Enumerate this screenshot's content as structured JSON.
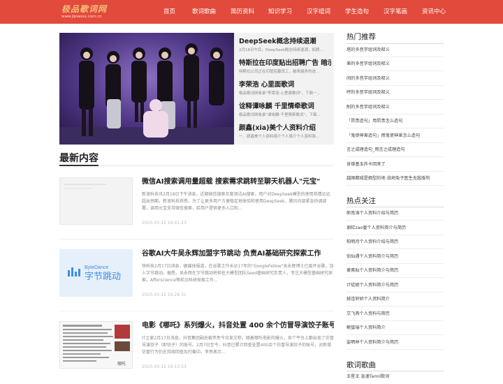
{
  "header": {
    "logo_name": "极品歌词网",
    "logo_url": "www.jlpiaoxx.com.cn",
    "nav": [
      "首页",
      "歌词歌曲",
      "简历资料",
      "知识学习",
      "汉字组词",
      "学生造句",
      "汉字笔画",
      "资讯中心"
    ]
  },
  "featured": {
    "headlines": [
      {
        "title": "DeepSeek概念持续退潮",
        "summary": "2月18日午后，DeepSeek概念持续退潮，拓朗..."
      },
      {
        "title": "特斯拉在印度贴出招聘广告 暗示",
        "summary": "特斯拉公司正在印度招募员工，越来越多的迹..."
      },
      {
        "title": "李荣浩 心里面歌词",
        "summary": "极品歌词网收录\"李荣浩-心里面歌词\"，下面一..."
      },
      {
        "title": "诠释谭咏麟 千里情牵歌词",
        "summary": "极品歌词网收录\"谭咏麟-千里情牵歌词\"，下面..."
      },
      {
        "title": "颜鑫(xia)美个人资料介绍",
        "summary": "一、颜鑫美个人资料简介个人简介个人资料简..."
      }
    ]
  },
  "latest": {
    "title": "最新内容",
    "articles": [
      {
        "title": "微信AI搜索调用量超载 搜索需求跳转至聊天机器人\"元宝\"",
        "summary": "新浪科技讯2月18日下午消息，近期微信搜索灰度测试AI搜索，用户对DeepSeek模型的使用热情远远超出预期，新浪科技获悉，为了让更多用户方便稳定地体验和使用DeepSeek，腾讯内部紧急协调部署，调用元宝支持微信搜索，给用户提供更多入口和...",
        "date": "2025-03-11 16:41:23",
        "thumb": "blank"
      },
      {
        "title": "谷歌AI大牛吴永辉加盟字节跳动 负责AI基础研究探索工作",
        "summary": "快科技2月17日消息，据媒体报道，在谷歌工作长达17年的\"GoogleFellow\"吴永辉博士已离开谷歌，加入字节跳动。据悉，吴永辉在字节跳动将担任大模型团队Seed基础研究负责人，专注大模型基础研究探索，Afforscience等前沿科研探索工作...",
        "date": "2025-03-11 16:28:31",
        "thumb": "bytedance",
        "thumb_en": "ByteDance",
        "thumb_cn": "字节跳动"
      },
      {
        "title": "电影《哪吒》系列爆火，抖音处置 400 余个仿冒导演饺子账号",
        "summary": "IT之家2月17日消息，抖音集团副总裁李亮今日发文称，随着哪吒电影的爆火，各个平台上都出现了仿冒导演饺子（即饺子）的账号。2月7日至今，抖音已累计回查处置400余个仿冒导演饺子的账号，对新增仿冒行为仍在持续回查及打截中。李亮表示...",
        "date": "2025-03-11 16:13:53",
        "thumb": "document",
        "thumb_mark": "哪吒"
      }
    ]
  },
  "sidebar": {
    "hot_title": "热门推荐",
    "hot": [
      "塔的多音字组词及释义",
      "差的多音字组词及释义",
      "间的多音字组词及释义",
      "呼的多音字组词及释义",
      "削的多音字组词及释义",
      "「昂贵造句」用昂贵怎么造句",
      "「鬼使神差造句」用鬼使神差怎么造句",
      "言之成理造句_用言之成理造句",
      "肯德基玉炸卡回来了",
      "越国都城是拥型的地 战地兔子医生无敌版利"
    ],
    "focus_title": "热点关注",
    "focus": [
      "郎南涛个人资料介绍与简历",
      "谢紅zao量个人资料简介与简历",
      "柏明月个人资料介绍与简历",
      "伯仙遇个人资料简介与简历",
      "黄菁耘个人资料简介与简历",
      "计徒妮个人资料简介与简历",
      "赫连轩娇个人资料简介",
      "艾飞燕个人资料与简历",
      "鲍蛰瑞个人资料简介",
      "娑晒林个人资料简介与简历"
    ],
    "lyrics_title": "歌词歌曲",
    "lyrics_first": "王星王 急速Tamil歌词"
  },
  "colors": {
    "header": "#e24a3b",
    "logo": "#f5c07a"
  }
}
